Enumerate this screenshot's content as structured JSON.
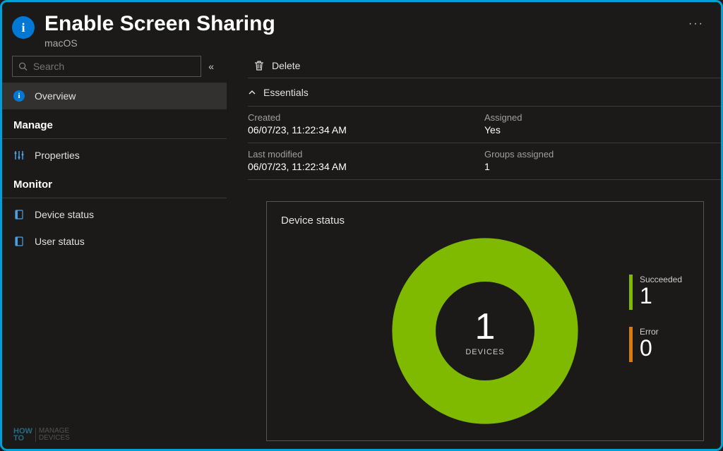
{
  "header": {
    "title": "Enable Screen Sharing",
    "subtitle": "macOS",
    "more": "···"
  },
  "sidebar": {
    "search_placeholder": "Search",
    "collapse_glyph": "«",
    "items": {
      "overview": "Overview",
      "section_manage": "Manage",
      "properties": "Properties",
      "section_monitor": "Monitor",
      "device_status": "Device status",
      "user_status": "User status"
    }
  },
  "toolbar": {
    "delete": "Delete"
  },
  "essentials": {
    "header": "Essentials",
    "created_label": "Created",
    "created_value": "06/07/23, 11:22:34 AM",
    "assigned_label": "Assigned",
    "assigned_value": "Yes",
    "lastmod_label": "Last modified",
    "lastmod_value": "06/07/23, 11:22:34 AM",
    "groups_label": "Groups assigned",
    "groups_value": "1"
  },
  "chart": {
    "title": "Device status",
    "center_value": "1",
    "center_label": "DEVICES",
    "legend": {
      "succeeded_label": "Succeeded",
      "succeeded_value": "1",
      "error_label": "Error",
      "error_value": "0"
    }
  },
  "chart_data": {
    "type": "pie",
    "title": "Device status",
    "series": [
      {
        "name": "Succeeded",
        "value": 1,
        "color": "#7fba00"
      },
      {
        "name": "Error",
        "value": 0,
        "color": "#d97b0d"
      }
    ],
    "total_label": "DEVICES",
    "total_value": 1
  },
  "colors": {
    "accent": "#0078d4",
    "success": "#7fba00",
    "error": "#d97b0d"
  },
  "watermark": {
    "line1": "HOW",
    "line2": "TO",
    "rest1": "MANAGE",
    "rest2": "DEVICES"
  }
}
